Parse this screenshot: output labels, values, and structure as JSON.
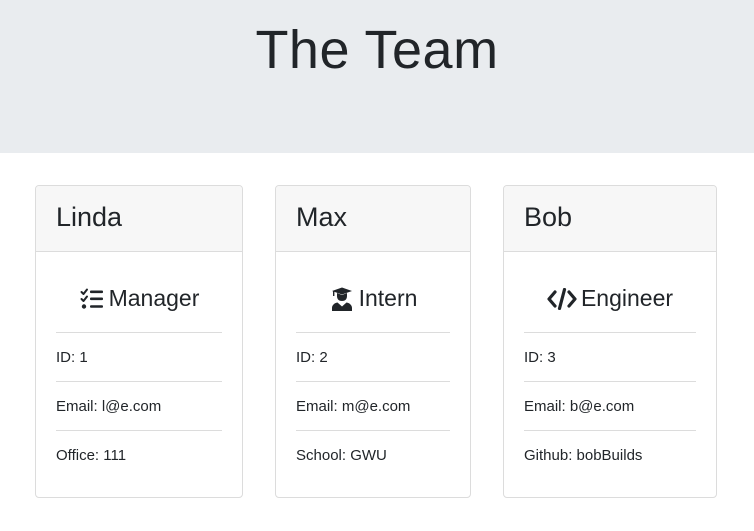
{
  "header": {
    "title": "The Team"
  },
  "employees": [
    {
      "name": "Linda",
      "role": "Manager",
      "icon": "tasks-icon",
      "id_text": "ID: 1",
      "email_text": "Email: l@e.com",
      "extra_text": "Office: 111"
    },
    {
      "name": "Max",
      "role": "Intern",
      "icon": "user-graduate-icon",
      "id_text": "ID: 2",
      "email_text": "Email: m@e.com",
      "extra_text": "School: GWU"
    },
    {
      "name": "Bob",
      "role": "Engineer",
      "icon": "code-icon",
      "id_text": "ID: 3",
      "email_text": "Email: b@e.com",
      "extra_text": "Github: bobBuilds"
    }
  ],
  "colors": {
    "jumbotron_bg": "#e9ecef",
    "card_header_bg": "#f7f7f7",
    "border": "#dcdcdc",
    "text": "#212529"
  }
}
